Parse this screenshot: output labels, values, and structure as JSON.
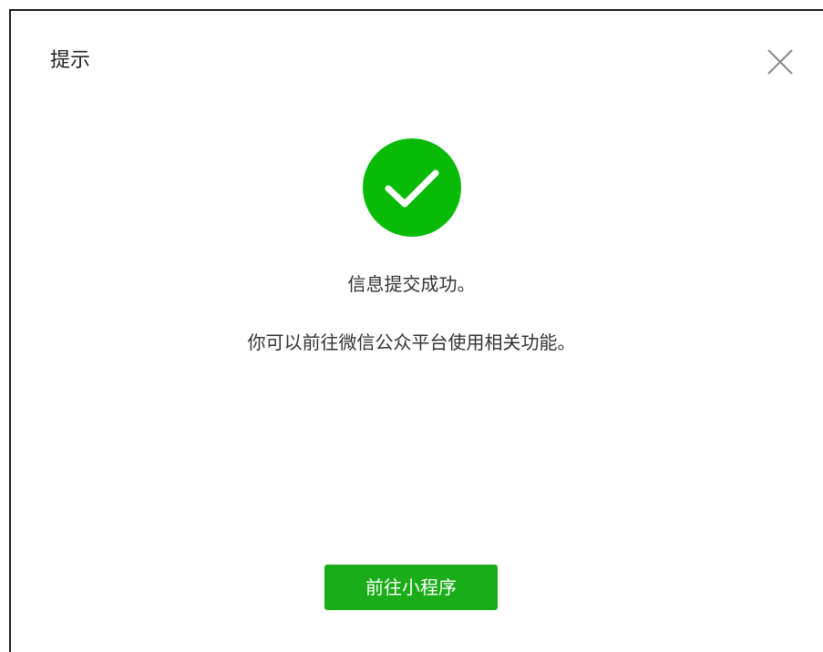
{
  "dialog": {
    "title": "提示",
    "close_icon": "close-icon",
    "success_icon": "check-circle-icon",
    "message_title": "信息提交成功。",
    "message_desc": "你可以前往微信公众平台使用相关功能。",
    "primary_button_label": "前往小程序"
  },
  "colors": {
    "accent": "#1aad19",
    "success": "#09bb07",
    "text": "#333333",
    "close": "#888888"
  }
}
